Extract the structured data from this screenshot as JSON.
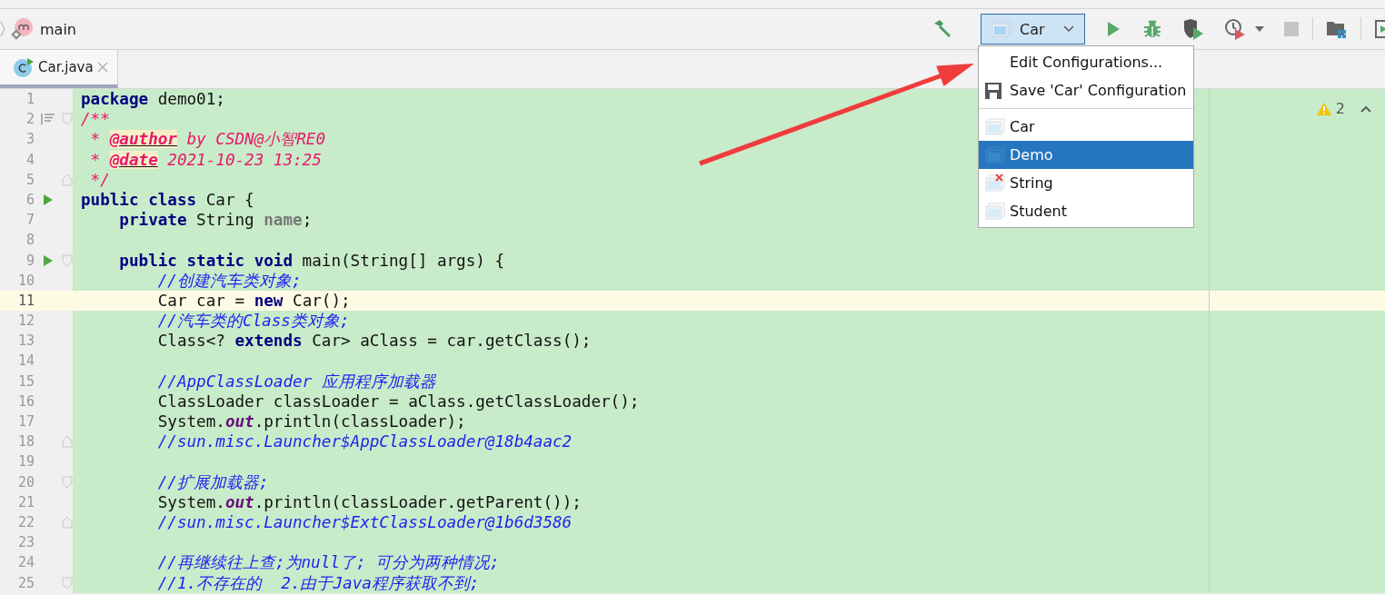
{
  "breadcrumb": {
    "label": "main"
  },
  "toolbar": {
    "run_config": "Car",
    "stop_disabled": true
  },
  "tabs": [
    {
      "label": "Car.java",
      "selected": true
    }
  ],
  "editor": {
    "warnings": "2",
    "lines": [
      {
        "n": "1",
        "current": false,
        "tokens": [
          {
            "t": "package",
            "kind": "kw"
          },
          {
            "t": " demo01;",
            "kind": "plain"
          }
        ]
      },
      {
        "n": "2",
        "current": false,
        "markers": [
          {
            "kind": "structure"
          },
          {
            "kind": "fold_start"
          }
        ],
        "tokens": [
          {
            "t": "/**",
            "kind": "doc"
          }
        ]
      },
      {
        "n": "3",
        "current": false,
        "tokens": [
          {
            "t": " * ",
            "kind": "doc"
          },
          {
            "t": "@author",
            "kind": "tag"
          },
          {
            "t": " by CSDN@小智RE0",
            "kind": "doc"
          }
        ]
      },
      {
        "n": "4",
        "current": false,
        "tokens": [
          {
            "t": " * ",
            "kind": "doc"
          },
          {
            "t": "@date",
            "kind": "tag"
          },
          {
            "t": " 2021-10-23 13:25",
            "kind": "doc"
          }
        ]
      },
      {
        "n": "5",
        "current": false,
        "markers": [
          {
            "kind": "fold_end"
          }
        ],
        "tokens": [
          {
            "t": " */",
            "kind": "doc"
          }
        ]
      },
      {
        "n": "6",
        "current": false,
        "markers": [
          {
            "kind": "run"
          }
        ],
        "tokens": [
          {
            "t": "public class",
            "kind": "kw"
          },
          {
            "t": " Car {",
            "kind": "plain"
          }
        ]
      },
      {
        "n": "7",
        "current": false,
        "tokens": [
          {
            "t": "    private",
            "kind": "kw"
          },
          {
            "t": " String ",
            "kind": "plain"
          },
          {
            "t": "name",
            "kind": "field"
          },
          {
            "t": ";",
            "kind": "plain"
          }
        ]
      },
      {
        "n": "8",
        "current": false
      },
      {
        "n": "9",
        "current": false,
        "markers": [
          {
            "kind": "run"
          },
          {
            "kind": "fold_start"
          }
        ],
        "tokens": [
          {
            "t": "    public static void",
            "kind": "kw"
          },
          {
            "t": " main(String[] args) {",
            "kind": "plain"
          }
        ]
      },
      {
        "n": "10",
        "current": false,
        "tokens": [
          {
            "t": "        //创建汽车类对象;",
            "kind": "comment"
          }
        ]
      },
      {
        "n": "11",
        "current": true,
        "tokens": [
          {
            "t": "        Car car = ",
            "kind": "plain"
          },
          {
            "t": "new",
            "kind": "kw"
          },
          {
            "t": " Car();",
            "kind": "plain"
          }
        ]
      },
      {
        "n": "12",
        "current": false,
        "tokens": [
          {
            "t": "        //汽车类的Class类对象;",
            "kind": "comment"
          }
        ]
      },
      {
        "n": "13",
        "current": false,
        "tokens": [
          {
            "t": "        Class<? ",
            "kind": "plain"
          },
          {
            "t": "extends",
            "kind": "kw"
          },
          {
            "t": " Car> aClass = car.getClass();",
            "kind": "plain"
          }
        ]
      },
      {
        "n": "14",
        "current": false
      },
      {
        "n": "15",
        "current": false,
        "tokens": [
          {
            "t": "        //AppClassLoader 应用程序加载器",
            "kind": "comment"
          }
        ]
      },
      {
        "n": "16",
        "current": false,
        "tokens": [
          {
            "t": "        ClassLoader classLoader = aClass.getClassLoader();",
            "kind": "plain"
          }
        ]
      },
      {
        "n": "17",
        "current": false,
        "tokens": [
          {
            "t": "        System.",
            "kind": "plain"
          },
          {
            "t": "out",
            "kind": "static"
          },
          {
            "t": ".println(classLoader);",
            "kind": "plain"
          }
        ]
      },
      {
        "n": "18",
        "current": false,
        "markers": [
          {
            "kind": "fold_end"
          }
        ],
        "tokens": [
          {
            "t": "        //sun.misc.Launcher$AppClassLoader@18b4aac2",
            "kind": "comment"
          }
        ]
      },
      {
        "n": "19",
        "current": false
      },
      {
        "n": "20",
        "current": false,
        "markers": [
          {
            "kind": "fold_start"
          }
        ],
        "tokens": [
          {
            "t": "        //扩展加载器;",
            "kind": "comment"
          }
        ]
      },
      {
        "n": "21",
        "current": false,
        "tokens": [
          {
            "t": "        System.",
            "kind": "plain"
          },
          {
            "t": "out",
            "kind": "static"
          },
          {
            "t": ".println(classLoader.getParent());",
            "kind": "plain"
          }
        ]
      },
      {
        "n": "22",
        "current": false,
        "markers": [
          {
            "kind": "fold_end"
          }
        ],
        "tokens": [
          {
            "t": "        //sun.misc.Launcher$ExtClassLoader@1b6d3586",
            "kind": "comment"
          }
        ]
      },
      {
        "n": "23",
        "current": false
      },
      {
        "n": "24",
        "current": false,
        "tokens": [
          {
            "t": "        //再继续往上查;为null了; 可分为两种情况;",
            "kind": "comment"
          }
        ]
      },
      {
        "n": "25",
        "current": false,
        "markers": [
          {
            "kind": "fold_start"
          }
        ],
        "tokens": [
          {
            "t": "        //1.不存在的  2.由于Java程序获取不到;",
            "kind": "comment"
          }
        ]
      }
    ]
  },
  "config_menu": {
    "actions": [
      {
        "label": "Edit Configurations...",
        "kind": "plain"
      },
      {
        "label": "Save 'Car' Configuration",
        "kind": "save"
      }
    ],
    "configurations": [
      {
        "label": "Car",
        "selected": false,
        "error": false
      },
      {
        "label": "Demo",
        "selected": true,
        "error": false
      },
      {
        "label": "String",
        "selected": false,
        "error": true
      },
      {
        "label": "Student",
        "selected": false,
        "error": false
      }
    ]
  }
}
